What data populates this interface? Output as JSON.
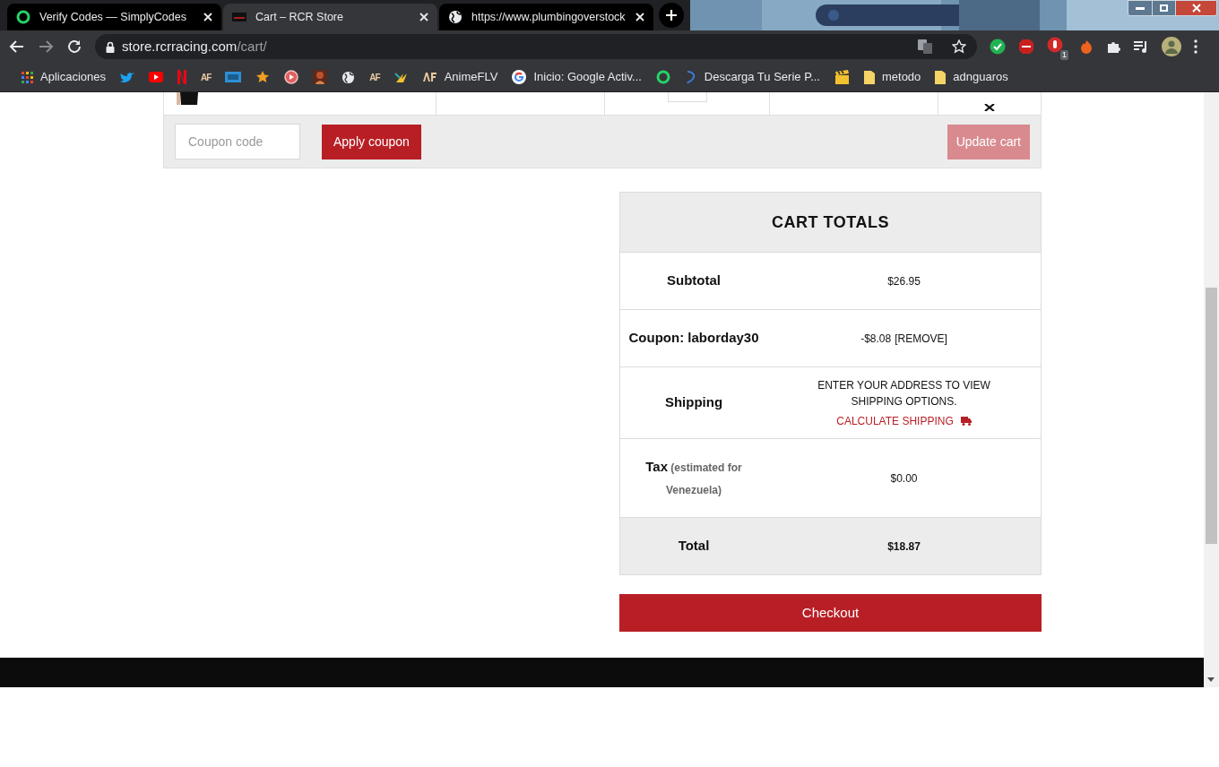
{
  "browser": {
    "tabs": [
      {
        "title": "Verify Codes — SimplyCodes",
        "selected": false
      },
      {
        "title": "Cart – RCR Store",
        "selected": true
      },
      {
        "title": "https://www.plumbingoverstock",
        "selected": false
      }
    ],
    "address": {
      "host": "store.rcrracing.com",
      "path": "/cart/"
    },
    "extension_badge": "1",
    "bookmarks": [
      "Aplicaciones",
      "AF",
      "AF",
      "AnimeFLV",
      "Inicio: Google Activ...",
      "Descarga Tu Serie P...",
      "metodo",
      "adnguaros"
    ]
  },
  "cart": {
    "coupon_field": {
      "placeholder": "Coupon code"
    },
    "apply_button": {
      "label": "Apply coupon",
      "disabled": false
    },
    "update_button": {
      "label": "Update cart",
      "disabled": true
    }
  },
  "totals": {
    "title": "CART TOTALS",
    "rows": [
      {
        "kind": "plain",
        "label": "Subtotal",
        "value": "$26.95"
      },
      {
        "kind": "coupon",
        "label": "Coupon: laborday30",
        "value": "-$8.08",
        "link": "[REMOVE]"
      },
      {
        "kind": "shipping",
        "label": "Shipping",
        "value": "ENTER YOUR ADDRESS TO VIEW SHIPPING OPTIONS.",
        "link": "CALCULATE SHIPPING"
      },
      {
        "kind": "tax",
        "label": "Tax",
        "note": "(estimated for Venezuela)",
        "value": "$0.00"
      },
      {
        "kind": "total",
        "label": "Total",
        "value": "$18.87"
      }
    ],
    "checkout": "Checkout"
  }
}
